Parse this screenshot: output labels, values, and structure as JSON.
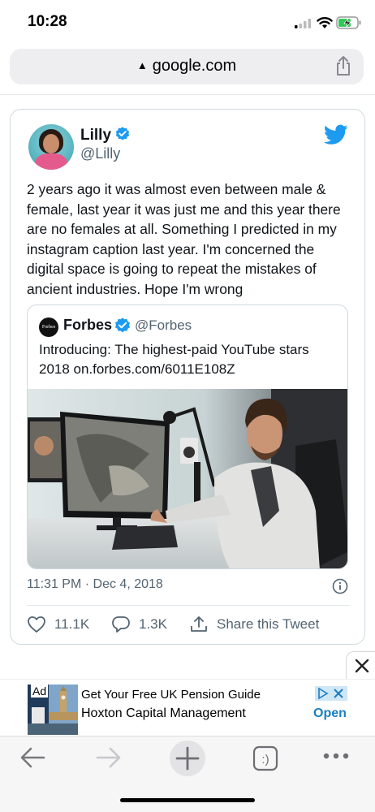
{
  "status_bar": {
    "time": "10:28"
  },
  "browser": {
    "url": "google.com",
    "icons": [
      "warning-icon",
      "share-icon"
    ]
  },
  "tweet": {
    "author_name": "Lilly",
    "author_handle": "@Lilly",
    "text": "2 years ago it was almost even between male & female, last year it was just me and this year there are no females at all. Something I predicted in my instagram caption last year. I'm concerned the digital space is going to repeat the mistakes of ancient industries. Hope I'm wrong",
    "timestamp": "11:31 PM · Dec 4, 2018",
    "likes": "11.1K",
    "replies": "1.3K",
    "share_label": "Share this Tweet",
    "quote": {
      "logo_text": "Forbes",
      "author_name": "Forbes",
      "author_handle": "@Forbes",
      "text": "Introducing: The highest-paid YouTube stars 2018 on.forbes.com/6011E108Z"
    }
  },
  "ad": {
    "label": "Ad",
    "title": "Get Your Free UK Pension Guide",
    "company": "Hoxton Capital Management",
    "cta": "Open"
  },
  "colors": {
    "twitter_blue": "#1d9bf0",
    "text_secondary": "#536471",
    "ad_link": "#1a7fc1"
  }
}
